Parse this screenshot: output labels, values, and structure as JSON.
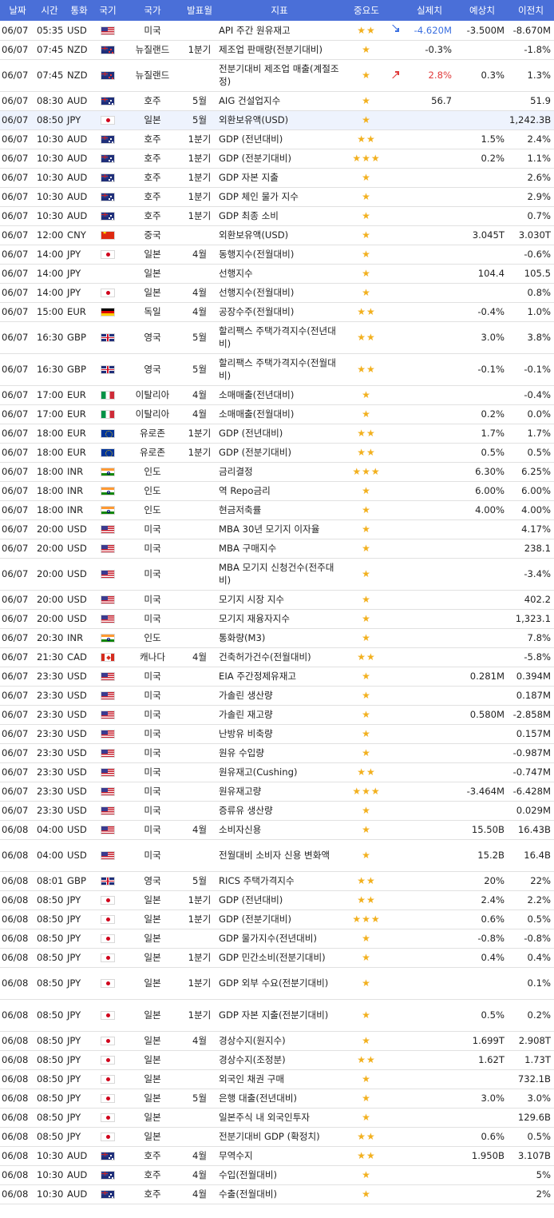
{
  "headers": {
    "date": "날짜",
    "time": "시간",
    "currency": "통화",
    "flag": "국기",
    "country": "국가",
    "period": "발표월",
    "indicator": "지표",
    "importance": "중요도",
    "actual": "실제치",
    "forecast": "예상치",
    "previous": "이전치"
  },
  "colors": {
    "header_bg": "#4a6fd8",
    "star": "#f2b01e",
    "actual_up": "#e03a3a",
    "actual_down": "#3a6fe0",
    "highlight_row": "#eef3fd"
  },
  "rows": [
    {
      "date": "06/07",
      "time": "05:35",
      "currency": "USD",
      "flag": "us-flag",
      "country": "미국",
      "period": "",
      "indicator": "API 주간 원유재고",
      "importance": "★★",
      "trend": "down",
      "actual": "-4.620M",
      "forecast": "-3.500M",
      "previous": "-8.670M"
    },
    {
      "date": "06/07",
      "time": "07:45",
      "currency": "NZD",
      "flag": "nz-flag",
      "country": "뉴질랜드",
      "period": "1분기",
      "indicator": "제조업 판매량(전분기대비)",
      "importance": "★",
      "trend": "",
      "actual": "-0.3%",
      "forecast": "",
      "previous": "-1.8%"
    },
    {
      "date": "06/07",
      "time": "07:45",
      "currency": "NZD",
      "flag": "nz-flag",
      "country": "뉴질랜드",
      "period": "",
      "indicator": "전분기대비 제조업 매출(계절조정)",
      "importance": "★",
      "trend": "up",
      "actual": "2.8%",
      "forecast": "0.3%",
      "previous": "1.3%",
      "tall": true
    },
    {
      "date": "06/07",
      "time": "08:30",
      "currency": "AUD",
      "flag": "au-flag",
      "country": "호주",
      "period": "5월",
      "indicator": "AIG 건설업지수",
      "importance": "★",
      "trend": "",
      "actual": "56.7",
      "forecast": "",
      "previous": "51.9"
    },
    {
      "date": "06/07",
      "time": "08:50",
      "currency": "JPY",
      "flag": "jp-flag",
      "country": "일본",
      "period": "5월",
      "indicator": "외환보유액(USD)",
      "importance": "★",
      "trend": "",
      "actual": "",
      "forecast": "",
      "previous": "1,242.3B",
      "highlight": true
    },
    {
      "date": "06/07",
      "time": "10:30",
      "currency": "AUD",
      "flag": "au-flag",
      "country": "호주",
      "period": "1분기",
      "indicator": "GDP (전년대비)",
      "importance": "★★",
      "trend": "",
      "actual": "",
      "forecast": "1.5%",
      "previous": "2.4%"
    },
    {
      "date": "06/07",
      "time": "10:30",
      "currency": "AUD",
      "flag": "au-flag",
      "country": "호주",
      "period": "1분기",
      "indicator": "GDP (전분기대비)",
      "importance": "★★★",
      "trend": "",
      "actual": "",
      "forecast": "0.2%",
      "previous": "1.1%"
    },
    {
      "date": "06/07",
      "time": "10:30",
      "currency": "AUD",
      "flag": "au-flag",
      "country": "호주",
      "period": "1분기",
      "indicator": "GDP 자본 지출",
      "importance": "★",
      "trend": "",
      "actual": "",
      "forecast": "",
      "previous": "2.6%"
    },
    {
      "date": "06/07",
      "time": "10:30",
      "currency": "AUD",
      "flag": "au-flag",
      "country": "호주",
      "period": "1분기",
      "indicator": "GDP 체인 물가 지수",
      "importance": "★",
      "trend": "",
      "actual": "",
      "forecast": "",
      "previous": "2.9%"
    },
    {
      "date": "06/07",
      "time": "10:30",
      "currency": "AUD",
      "flag": "au-flag",
      "country": "호주",
      "period": "1분기",
      "indicator": "GDP 최종 소비",
      "importance": "★",
      "trend": "",
      "actual": "",
      "forecast": "",
      "previous": "0.7%"
    },
    {
      "date": "06/07",
      "time": "12:00",
      "currency": "CNY",
      "flag": "cn-flag",
      "country": "중국",
      "period": "",
      "indicator": "외환보유액(USD)",
      "importance": "★",
      "trend": "",
      "actual": "",
      "forecast": "3.045T",
      "previous": "3.030T"
    },
    {
      "date": "06/07",
      "time": "14:00",
      "currency": "JPY",
      "flag": "jp-flag",
      "country": "일본",
      "period": "4월",
      "indicator": "동행지수(전월대비)",
      "importance": "★",
      "trend": "",
      "actual": "",
      "forecast": "",
      "previous": "-0.6%"
    },
    {
      "date": "06/07",
      "time": "14:00",
      "currency": "JPY",
      "flag": "",
      "country": "일본",
      "period": "",
      "indicator": "선행지수",
      "importance": "★",
      "trend": "",
      "actual": "",
      "forecast": "104.4",
      "previous": "105.5"
    },
    {
      "date": "06/07",
      "time": "14:00",
      "currency": "JPY",
      "flag": "jp-flag",
      "country": "일본",
      "period": "4월",
      "indicator": "선행지수(전월대비)",
      "importance": "★",
      "trend": "",
      "actual": "",
      "forecast": "",
      "previous": "0.8%"
    },
    {
      "date": "06/07",
      "time": "15:00",
      "currency": "EUR",
      "flag": "de-flag",
      "country": "독일",
      "period": "4월",
      "indicator": "공장수주(전월대비)",
      "importance": "★★",
      "trend": "",
      "actual": "",
      "forecast": "-0.4%",
      "previous": "1.0%"
    },
    {
      "date": "06/07",
      "time": "16:30",
      "currency": "GBP",
      "flag": "gb-flag",
      "country": "영국",
      "period": "5월",
      "indicator": "할리팩스 주택가격지수(전년대비)",
      "importance": "★★",
      "trend": "",
      "actual": "",
      "forecast": "3.0%",
      "previous": "3.8%",
      "tall": true
    },
    {
      "date": "06/07",
      "time": "16:30",
      "currency": "GBP",
      "flag": "gb-flag",
      "country": "영국",
      "period": "5월",
      "indicator": "할리팩스 주택가격지수(전월대비)",
      "importance": "★★",
      "trend": "",
      "actual": "",
      "forecast": "-0.1%",
      "previous": "-0.1%",
      "tall": true
    },
    {
      "date": "06/07",
      "time": "17:00",
      "currency": "EUR",
      "flag": "it-flag",
      "country": "이탈리아",
      "period": "4월",
      "indicator": "소매매출(전년대비)",
      "importance": "★",
      "trend": "",
      "actual": "",
      "forecast": "",
      "previous": "-0.4%"
    },
    {
      "date": "06/07",
      "time": "17:00",
      "currency": "EUR",
      "flag": "it-flag",
      "country": "이탈리아",
      "period": "4월",
      "indicator": "소매매출(전월대비)",
      "importance": "★",
      "trend": "",
      "actual": "",
      "forecast": "0.2%",
      "previous": "0.0%"
    },
    {
      "date": "06/07",
      "time": "18:00",
      "currency": "EUR",
      "flag": "eu-flag",
      "country": "유로존",
      "period": "1분기",
      "indicator": "GDP (전년대비)",
      "importance": "★★",
      "trend": "",
      "actual": "",
      "forecast": "1.7%",
      "previous": "1.7%"
    },
    {
      "date": "06/07",
      "time": "18:00",
      "currency": "EUR",
      "flag": "eu-flag",
      "country": "유로존",
      "period": "1분기",
      "indicator": "GDP (전분기대비)",
      "importance": "★★",
      "trend": "",
      "actual": "",
      "forecast": "0.5%",
      "previous": "0.5%"
    },
    {
      "date": "06/07",
      "time": "18:00",
      "currency": "INR",
      "flag": "in-flag",
      "country": "인도",
      "period": "",
      "indicator": "금리결정",
      "importance": "★★★",
      "trend": "",
      "actual": "",
      "forecast": "6.30%",
      "previous": "6.25%"
    },
    {
      "date": "06/07",
      "time": "18:00",
      "currency": "INR",
      "flag": "in-flag",
      "country": "인도",
      "period": "",
      "indicator": "역 Repo금리",
      "importance": "★",
      "trend": "",
      "actual": "",
      "forecast": "6.00%",
      "previous": "6.00%"
    },
    {
      "date": "06/07",
      "time": "18:00",
      "currency": "INR",
      "flag": "in-flag",
      "country": "인도",
      "period": "",
      "indicator": "현금저축률",
      "importance": "★",
      "trend": "",
      "actual": "",
      "forecast": "4.00%",
      "previous": "4.00%"
    },
    {
      "date": "06/07",
      "time": "20:00",
      "currency": "USD",
      "flag": "us-flag",
      "country": "미국",
      "period": "",
      "indicator": "MBA 30년 모기지 이자율",
      "importance": "★",
      "trend": "",
      "actual": "",
      "forecast": "",
      "previous": "4.17%"
    },
    {
      "date": "06/07",
      "time": "20:00",
      "currency": "USD",
      "flag": "us-flag",
      "country": "미국",
      "period": "",
      "indicator": "MBA 구매지수",
      "importance": "★",
      "trend": "",
      "actual": "",
      "forecast": "",
      "previous": "238.1"
    },
    {
      "date": "06/07",
      "time": "20:00",
      "currency": "USD",
      "flag": "us-flag",
      "country": "미국",
      "period": "",
      "indicator": "MBA 모기지 신청건수(전주대비)",
      "importance": "★",
      "trend": "",
      "actual": "",
      "forecast": "",
      "previous": "-3.4%",
      "tall": true
    },
    {
      "date": "06/07",
      "time": "20:00",
      "currency": "USD",
      "flag": "us-flag",
      "country": "미국",
      "period": "",
      "indicator": "모기지 시장 지수",
      "importance": "★",
      "trend": "",
      "actual": "",
      "forecast": "",
      "previous": "402.2"
    },
    {
      "date": "06/07",
      "time": "20:00",
      "currency": "USD",
      "flag": "us-flag",
      "country": "미국",
      "period": "",
      "indicator": "모기지 재융자지수",
      "importance": "★",
      "trend": "",
      "actual": "",
      "forecast": "",
      "previous": "1,323.1"
    },
    {
      "date": "06/07",
      "time": "20:30",
      "currency": "INR",
      "flag": "in-flag",
      "country": "인도",
      "period": "",
      "indicator": "통화량(M3)",
      "importance": "★",
      "trend": "",
      "actual": "",
      "forecast": "",
      "previous": "7.8%"
    },
    {
      "date": "06/07",
      "time": "21:30",
      "currency": "CAD",
      "flag": "ca-flag",
      "country": "캐나다",
      "period": "4월",
      "indicator": "건축허가건수(전월대비)",
      "importance": "★★",
      "trend": "",
      "actual": "",
      "forecast": "",
      "previous": "-5.8%"
    },
    {
      "date": "06/07",
      "time": "23:30",
      "currency": "USD",
      "flag": "us-flag",
      "country": "미국",
      "period": "",
      "indicator": "EIA 주간정제유재고",
      "importance": "★",
      "trend": "",
      "actual": "",
      "forecast": "0.281M",
      "previous": "0.394M"
    },
    {
      "date": "06/07",
      "time": "23:30",
      "currency": "USD",
      "flag": "us-flag",
      "country": "미국",
      "period": "",
      "indicator": "가솔린 생산량",
      "importance": "★",
      "trend": "",
      "actual": "",
      "forecast": "",
      "previous": "0.187M"
    },
    {
      "date": "06/07",
      "time": "23:30",
      "currency": "USD",
      "flag": "us-flag",
      "country": "미국",
      "period": "",
      "indicator": "가솔린 재고량",
      "importance": "★",
      "trend": "",
      "actual": "",
      "forecast": "0.580M",
      "previous": "-2.858M"
    },
    {
      "date": "06/07",
      "time": "23:30",
      "currency": "USD",
      "flag": "us-flag",
      "country": "미국",
      "period": "",
      "indicator": "난방유 비축량",
      "importance": "★",
      "trend": "",
      "actual": "",
      "forecast": "",
      "previous": "0.157M"
    },
    {
      "date": "06/07",
      "time": "23:30",
      "currency": "USD",
      "flag": "us-flag",
      "country": "미국",
      "period": "",
      "indicator": "원유 수입량",
      "importance": "★",
      "trend": "",
      "actual": "",
      "forecast": "",
      "previous": "-0.987M"
    },
    {
      "date": "06/07",
      "time": "23:30",
      "currency": "USD",
      "flag": "us-flag",
      "country": "미국",
      "period": "",
      "indicator": "원유재고(Cushing)",
      "importance": "★★",
      "trend": "",
      "actual": "",
      "forecast": "",
      "previous": "-0.747M"
    },
    {
      "date": "06/07",
      "time": "23:30",
      "currency": "USD",
      "flag": "us-flag",
      "country": "미국",
      "period": "",
      "indicator": "원유재고량",
      "importance": "★★★",
      "trend": "",
      "actual": "",
      "forecast": "-3.464M",
      "previous": "-6.428M"
    },
    {
      "date": "06/07",
      "time": "23:30",
      "currency": "USD",
      "flag": "us-flag",
      "country": "미국",
      "period": "",
      "indicator": "증류유 생산량",
      "importance": "★",
      "trend": "",
      "actual": "",
      "forecast": "",
      "previous": "0.029M"
    },
    {
      "date": "06/08",
      "time": "04:00",
      "currency": "USD",
      "flag": "us-flag",
      "country": "미국",
      "period": "4월",
      "indicator": "소비자신용",
      "importance": "★",
      "trend": "",
      "actual": "",
      "forecast": "15.50B",
      "previous": "16.43B"
    },
    {
      "date": "06/08",
      "time": "04:00",
      "currency": "USD",
      "flag": "us-flag",
      "country": "미국",
      "period": "",
      "indicator": "전월대비 소비자 신용 변화액",
      "importance": "★",
      "trend": "",
      "actual": "",
      "forecast": "15.2B",
      "previous": "16.4B",
      "tall": true
    },
    {
      "date": "06/08",
      "time": "08:01",
      "currency": "GBP",
      "flag": "gb-flag",
      "country": "영국",
      "period": "5월",
      "indicator": "RICS 주택가격지수",
      "importance": "★★",
      "trend": "",
      "actual": "",
      "forecast": "20%",
      "previous": "22%"
    },
    {
      "date": "06/08",
      "time": "08:50",
      "currency": "JPY",
      "flag": "jp-flag",
      "country": "일본",
      "period": "1분기",
      "indicator": "GDP (전년대비)",
      "importance": "★★",
      "trend": "",
      "actual": "",
      "forecast": "2.4%",
      "previous": "2.2%"
    },
    {
      "date": "06/08",
      "time": "08:50",
      "currency": "JPY",
      "flag": "jp-flag",
      "country": "일본",
      "period": "1분기",
      "indicator": "GDP (전분기대비)",
      "importance": "★★★",
      "trend": "",
      "actual": "",
      "forecast": "0.6%",
      "previous": "0.5%"
    },
    {
      "date": "06/08",
      "time": "08:50",
      "currency": "JPY",
      "flag": "jp-flag",
      "country": "일본",
      "period": "",
      "indicator": "GDP 물가지수(전년대비)",
      "importance": "★",
      "trend": "",
      "actual": "",
      "forecast": "-0.8%",
      "previous": "-0.8%"
    },
    {
      "date": "06/08",
      "time": "08:50",
      "currency": "JPY",
      "flag": "jp-flag",
      "country": "일본",
      "period": "1분기",
      "indicator": "GDP 민간소비(전분기대비)",
      "importance": "★",
      "trend": "",
      "actual": "",
      "forecast": "0.4%",
      "previous": "0.4%"
    },
    {
      "date": "06/08",
      "time": "08:50",
      "currency": "JPY",
      "flag": "jp-flag",
      "country": "일본",
      "period": "1분기",
      "indicator": "GDP 외부 수요(전분기대비)",
      "importance": "★",
      "trend": "",
      "actual": "",
      "forecast": "",
      "previous": "0.1%",
      "tall": true
    },
    {
      "date": "06/08",
      "time": "08:50",
      "currency": "JPY",
      "flag": "jp-flag",
      "country": "일본",
      "period": "1분기",
      "indicator": "GDP 자본 지출(전분기대비)",
      "importance": "★",
      "trend": "",
      "actual": "",
      "forecast": "0.5%",
      "previous": "0.2%",
      "tall": true
    },
    {
      "date": "06/08",
      "time": "08:50",
      "currency": "JPY",
      "flag": "jp-flag",
      "country": "일본",
      "period": "4월",
      "indicator": "경상수지(원지수)",
      "importance": "★",
      "trend": "",
      "actual": "",
      "forecast": "1.699T",
      "previous": "2.908T"
    },
    {
      "date": "06/08",
      "time": "08:50",
      "currency": "JPY",
      "flag": "jp-flag",
      "country": "일본",
      "period": "",
      "indicator": "경상수지(조정분)",
      "importance": "★★",
      "trend": "",
      "actual": "",
      "forecast": "1.62T",
      "previous": "1.73T"
    },
    {
      "date": "06/08",
      "time": "08:50",
      "currency": "JPY",
      "flag": "jp-flag",
      "country": "일본",
      "period": "",
      "indicator": "외국인 채권 구매",
      "importance": "★",
      "trend": "",
      "actual": "",
      "forecast": "",
      "previous": "732.1B"
    },
    {
      "date": "06/08",
      "time": "08:50",
      "currency": "JPY",
      "flag": "jp-flag",
      "country": "일본",
      "period": "5월",
      "indicator": "은행 대출(전년대비)",
      "importance": "★",
      "trend": "",
      "actual": "",
      "forecast": "3.0%",
      "previous": "3.0%"
    },
    {
      "date": "06/08",
      "time": "08:50",
      "currency": "JPY",
      "flag": "jp-flag",
      "country": "일본",
      "period": "",
      "indicator": "일본주식 내 외국인투자",
      "importance": "★",
      "trend": "",
      "actual": "",
      "forecast": "",
      "previous": "129.6B"
    },
    {
      "date": "06/08",
      "time": "08:50",
      "currency": "JPY",
      "flag": "jp-flag",
      "country": "일본",
      "period": "",
      "indicator": "전분기대비 GDP (확정치)",
      "importance": "★★",
      "trend": "",
      "actual": "",
      "forecast": "0.6%",
      "previous": "0.5%"
    },
    {
      "date": "06/08",
      "time": "10:30",
      "currency": "AUD",
      "flag": "au-flag",
      "country": "호주",
      "period": "4월",
      "indicator": "무역수지",
      "importance": "★★",
      "trend": "",
      "actual": "",
      "forecast": "1.950B",
      "previous": "3.107B"
    },
    {
      "date": "06/08",
      "time": "10:30",
      "currency": "AUD",
      "flag": "au-flag",
      "country": "호주",
      "period": "4월",
      "indicator": "수입(전월대비)",
      "importance": "★",
      "trend": "",
      "actual": "",
      "forecast": "",
      "previous": "5%"
    },
    {
      "date": "06/08",
      "time": "10:30",
      "currency": "AUD",
      "flag": "au-flag",
      "country": "호주",
      "period": "4월",
      "indicator": "수출(전월대비)",
      "importance": "★",
      "trend": "",
      "actual": "",
      "forecast": "",
      "previous": "2%"
    }
  ]
}
